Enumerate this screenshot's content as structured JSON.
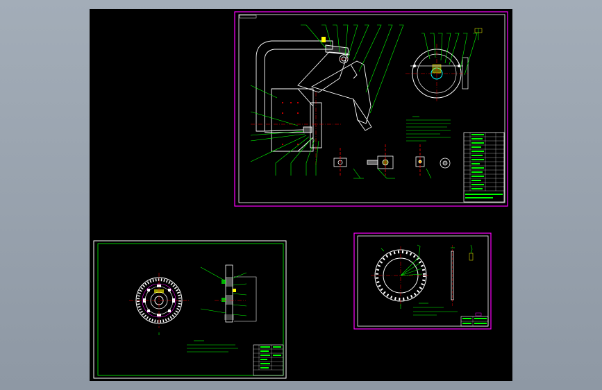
{
  "viewer": {
    "background_color": "#96a0ac",
    "model_space_color": "#000000"
  },
  "colors": {
    "frame_magenta": "#ff00ff",
    "frame_white": "#ffffff",
    "geometry_white": "#ffffff",
    "leader_green": "#00ff00",
    "centerline_red": "#ff0000",
    "dim_yellow": "#ffff00",
    "accent_cyan": "#00ffff"
  },
  "sheets": [
    {
      "id": "sheet-pedal-assembly",
      "kind": "assembly drawing"
    },
    {
      "id": "sheet-clutch-disc",
      "kind": "part drawing"
    },
    {
      "id": "sheet-friction-ring",
      "kind": "part drawing"
    }
  ]
}
